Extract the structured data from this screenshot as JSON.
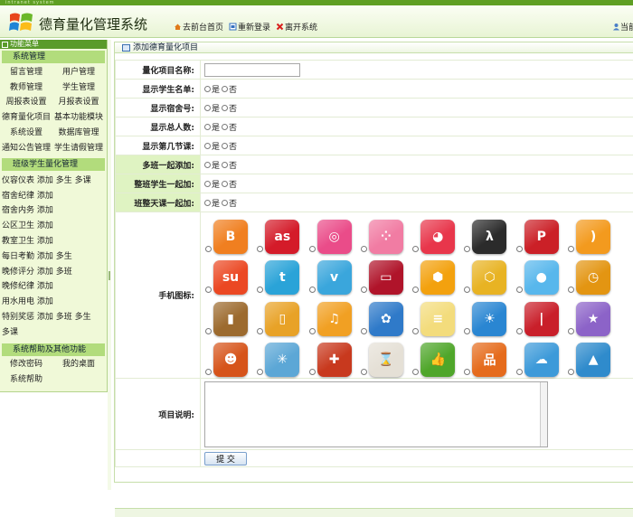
{
  "top_strip_text": "intranet system",
  "header": {
    "title": "德育量化管理系统",
    "nav": [
      {
        "label": "去前台首页",
        "icon": "home-icon"
      },
      {
        "label": "重新登录",
        "icon": "login-icon"
      },
      {
        "label": "离开系统",
        "icon": "close-icon"
      }
    ],
    "user_label": "当前"
  },
  "sidebar": {
    "header": "功能菜单",
    "group1": "系统管理",
    "sys_rows": [
      [
        "留言管理",
        "用户管理"
      ],
      [
        "教师管理",
        "学生管理"
      ],
      [
        "周报表设置",
        "月报表设置"
      ],
      [
        "德育量化项目",
        "基本功能模块"
      ],
      [
        "系统设置",
        "数据库管理"
      ],
      [
        "通知公告管理",
        "学生请假管理"
      ]
    ],
    "group2": "班级学生量化管理",
    "class_rows": [
      "仪容仪表 添加 多生 多课",
      "宿舍纪律 添加",
      "宿舍内务 添加",
      "公区卫生 添加",
      "教室卫生 添加",
      "每日考勤 添加 多生",
      "晚修评分 添加 多班",
      "晚修纪律 添加",
      "用水用电 添加",
      "特别奖惩 添加 多班 多生",
      "多课"
    ],
    "group3": "系统帮助及其他功能",
    "help_rows": [
      [
        "修改密码",
        "我的桌面"
      ],
      [
        "系统帮助",
        ""
      ]
    ]
  },
  "content": {
    "title": "添加德育量化项目",
    "fields": {
      "name_label": "量化项目名称:",
      "name_value": "",
      "show_student_label": "显示学生名单:",
      "show_dorm_label": "显示宿舍号:",
      "show_total_label": "显示总人数:",
      "show_lesson_label": "显示第几节课:",
      "multi_class_label": "多班一起添加:",
      "whole_class_label": "整班学生一起加:",
      "class_day_label": "班整天课一起加:",
      "icon_label": "手机图标:",
      "desc_label": "项目说明:"
    },
    "yes_label": "是",
    "no_label": "否",
    "submit_label": "提 交",
    "icons": [
      [
        {
          "name": "blogger-icon",
          "color": "#f07f20",
          "glyph": "B"
        },
        {
          "name": "lastfm-icon",
          "color": "#d41b29",
          "glyph": "as"
        },
        {
          "name": "dribbble-icon",
          "color": "#ea4c89",
          "glyph": "◎"
        },
        {
          "name": "dots-grid-icon",
          "color": "#f17ca3",
          "glyph": "⁘"
        },
        {
          "name": "pacman-icon",
          "color": "#e8364b",
          "glyph": "◕"
        },
        {
          "name": "lambda-icon",
          "color": "#2b2b2b",
          "glyph": "λ"
        },
        {
          "name": "pinterest-icon",
          "color": "#cb2027",
          "glyph": "P"
        },
        {
          "name": "rss-icon",
          "color": "#f39a1e",
          "glyph": ")"
        }
      ],
      [
        {
          "name": "stumbleupon-icon",
          "color": "#eb4823",
          "glyph": "su"
        },
        {
          "name": "twitter-icon",
          "color": "#2aa3d8",
          "glyph": "t"
        },
        {
          "name": "vimeo-icon",
          "color": "#3aa6dc",
          "glyph": "v"
        },
        {
          "name": "radio-device-icon",
          "color": "#b0142a",
          "glyph": "▭"
        },
        {
          "name": "hexagons-icon",
          "color": "#f3a10e",
          "glyph": "⬢"
        },
        {
          "name": "honeycomb-icon",
          "color": "#e8b323",
          "glyph": "⬡"
        },
        {
          "name": "camera-icon",
          "color": "#58b7ec",
          "glyph": "●"
        },
        {
          "name": "clock-icon",
          "color": "#e39512",
          "glyph": "◷"
        }
      ],
      [
        {
          "name": "address-book-icon",
          "color": "#9c6a2e",
          "glyph": "▮"
        },
        {
          "name": "drink-glass-icon",
          "color": "#e8a227",
          "glyph": "▯"
        },
        {
          "name": "music-notes-icon",
          "color": "#f1a023",
          "glyph": "♫"
        },
        {
          "name": "sunflower-icon",
          "color": "#2f7ac9",
          "glyph": "✿"
        },
        {
          "name": "notepad-icon",
          "color": "#f3dc7c",
          "glyph": "≡"
        },
        {
          "name": "weather-sun-icon",
          "color": "#2a86d2",
          "glyph": "☀"
        },
        {
          "name": "light-rays-icon",
          "color": "#c91f2a",
          "glyph": "|"
        },
        {
          "name": "stars-icon",
          "color": "#8c63c8",
          "glyph": "★"
        }
      ],
      [
        {
          "name": "pumpkin-icon",
          "color": "#d6541a",
          "glyph": "☻"
        },
        {
          "name": "glass-crack-icon",
          "color": "#5ca7d6",
          "glyph": "✳"
        },
        {
          "name": "puzzle-icon",
          "color": "#c8391e",
          "glyph": "✚"
        },
        {
          "name": "hourglass-icon",
          "color": "#e5e0d6",
          "glyph": "⌛"
        },
        {
          "name": "thumbs-up-icon",
          "color": "#4fa62a",
          "glyph": "👍"
        },
        {
          "name": "org-chart-icon",
          "color": "#e56b1c",
          "glyph": "品"
        },
        {
          "name": "cloud-sun-icon",
          "color": "#3d9ad9",
          "glyph": "☁"
        },
        {
          "name": "landscape-icon",
          "color": "#2f8bcc",
          "glyph": "▲"
        }
      ]
    ]
  }
}
